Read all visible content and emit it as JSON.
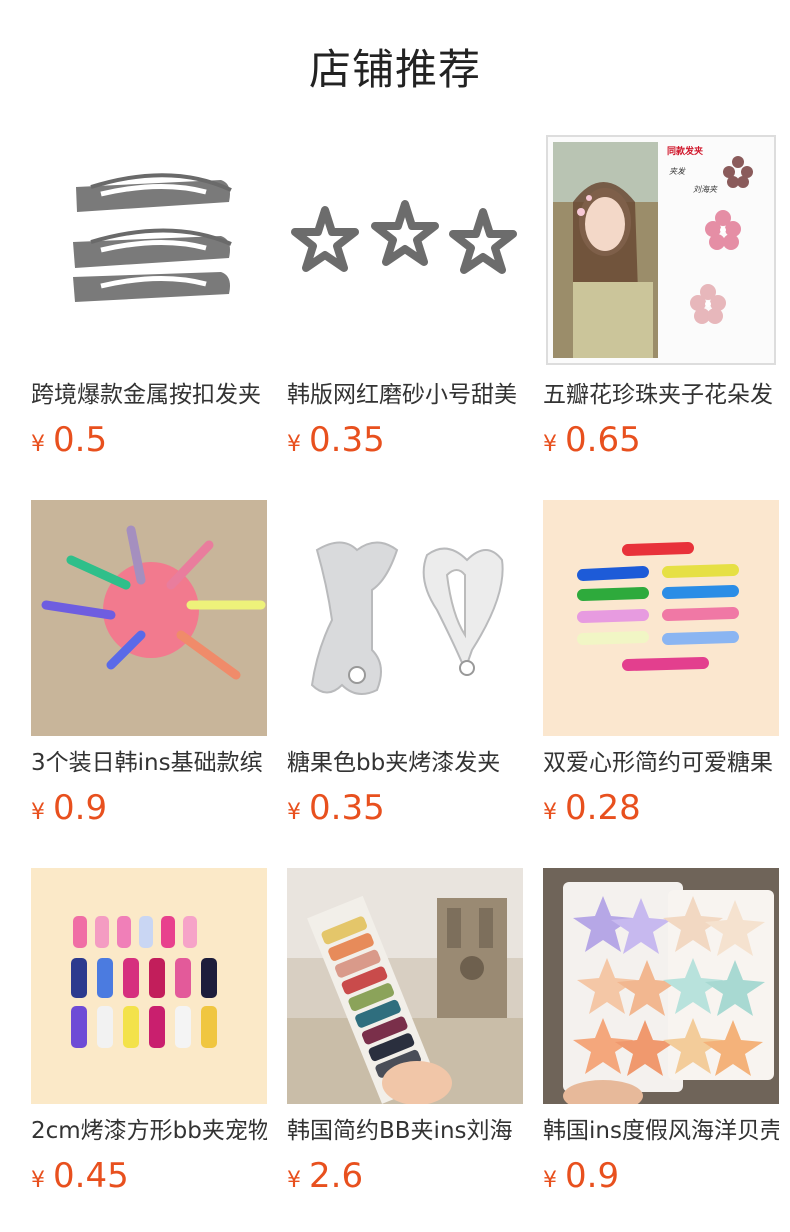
{
  "header": {
    "title": "店铺推荐"
  },
  "currency_symbol": "¥",
  "products": [
    {
      "title": "跨境爆款金属按扣发夹",
      "price": "0.5",
      "image": "grey-metal-snap-clips"
    },
    {
      "title": "韩版网红磨砂小号甜美",
      "price": "0.35",
      "image": "grey-star-clips"
    },
    {
      "title": "五瓣花珍珠夹子花朵发",
      "price": "0.65",
      "image": "girl-flower-clips-poster"
    },
    {
      "title": "3个装日韩ins基础款缤",
      "price": "0.9",
      "image": "colorful-paperclip-clips"
    },
    {
      "title": "糖果色bb夹烤漆发夹",
      "price": "0.35",
      "image": "silver-bb-clips"
    },
    {
      "title": "双爱心形简约可爱糖果",
      "price": "0.28",
      "image": "heart-clips-rainbow"
    },
    {
      "title": "2cm烤漆方形bb夹宠物",
      "price": "0.45",
      "image": "printed-square-bb-clips"
    },
    {
      "title": "韩国简约BB夹ins刘海",
      "price": "2.6",
      "image": "square-clips-card-city"
    },
    {
      "title": "韩国ins度假风海洋贝壳",
      "price": "0.9",
      "image": "starfish-clips-card"
    }
  ],
  "poster_text": {
    "line1": "同款发夹",
    "line2": "夹发",
    "line3": "刘海夹"
  }
}
